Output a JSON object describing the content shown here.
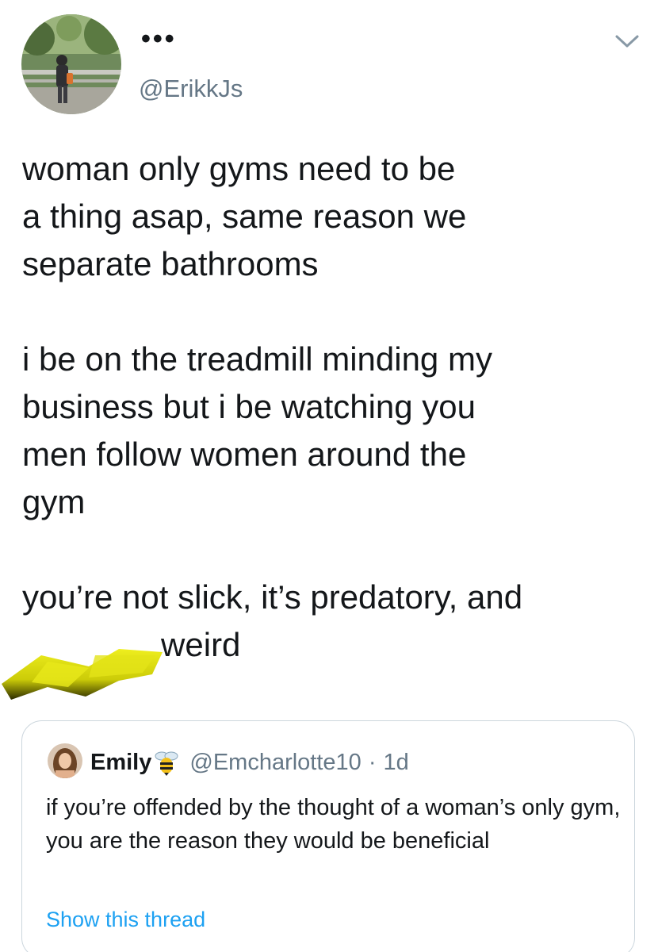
{
  "tweet": {
    "author": {
      "display_name": "•••",
      "handle": "@ErikkJs",
      "avatar_icon": "profile-photo"
    },
    "menu_icon": "chevron-down-icon",
    "text": "woman only gyms need to be\na thing asap, same reason we\nseparate bathrooms\n\ni be on the treadmill minding my\nbusiness but i be watching you\nmen follow women around the\ngym\n\nyou’re not slick, it’s predatory, and\n               weird"
  },
  "quoted_tweet": {
    "author": {
      "name": "Emily",
      "emoji_icon": "bee-icon",
      "handle": "@Emcharlotte10",
      "separator": "·",
      "time": "1d",
      "avatar_icon": "profile-photo"
    },
    "text": "if you’re offended by the thought of a woman’s only gym, you are the reason they would be beneficial",
    "show_thread": "Show this thread"
  },
  "colors": {
    "text": "#14171a",
    "secondary": "#657786",
    "link": "#1da1f2",
    "border": "#ccd6dd",
    "censor": "#d8d810"
  }
}
